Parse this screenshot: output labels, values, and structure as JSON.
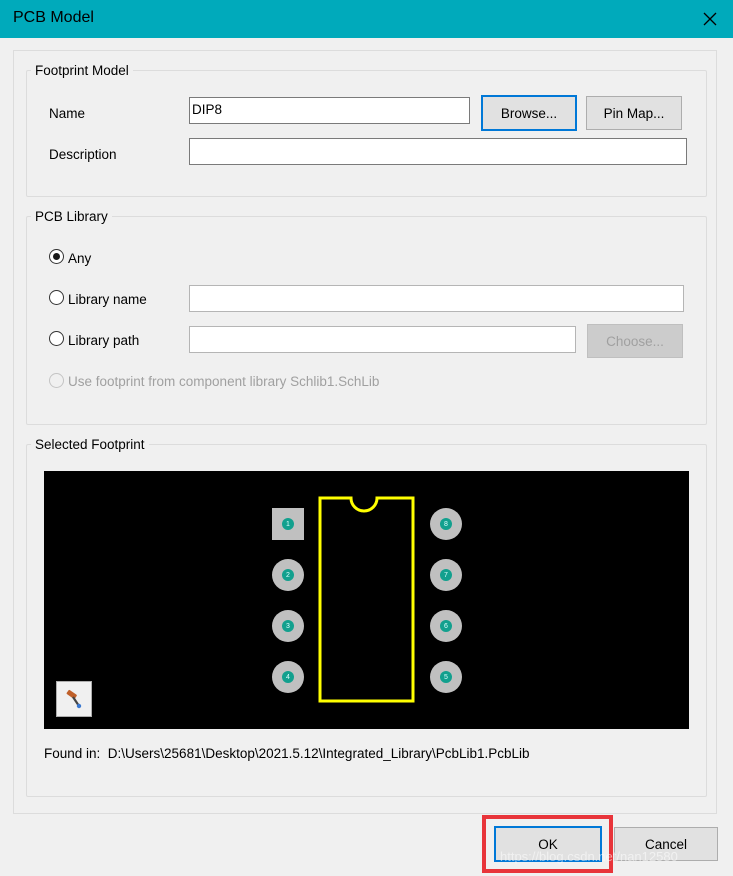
{
  "window": {
    "title": "PCB Model"
  },
  "footprint_model": {
    "legend": "Footprint Model",
    "name_label": "Name",
    "name_value": "DIP8",
    "description_label": "Description",
    "description_value": "",
    "browse_label": "Browse...",
    "pinmap_label": "Pin Map..."
  },
  "pcb_library": {
    "legend": "PCB Library",
    "any_label": "Any",
    "library_name_label": "Library name",
    "library_name_value": "",
    "library_path_label": "Library path",
    "library_path_value": "",
    "choose_label": "Choose...",
    "use_component_label": "Use footprint from component library Schlib1.SchLib",
    "selected": "Any"
  },
  "selected_footprint": {
    "legend": "Selected Footprint",
    "pins_left": [
      "1",
      "2",
      "3",
      "4"
    ],
    "pins_right": [
      "8",
      "7",
      "6",
      "5"
    ],
    "outline_color": "#ffff00",
    "pad_color": "#c0c0c0",
    "hole_color": "#12a08e",
    "found_in": "Found in:  D:\\Users\\25681\\Desktop\\2021.5.12\\Integrated_Library\\PcbLib1.PcbLib"
  },
  "footer": {
    "ok_label": "OK",
    "cancel_label": "Cancel",
    "watermark": "https://blog.csdn.net/nan12580"
  },
  "colors": {
    "titlebar": "#00aabb",
    "highlight_frame": "#e8343a",
    "default_button_border": "#0078d7"
  }
}
